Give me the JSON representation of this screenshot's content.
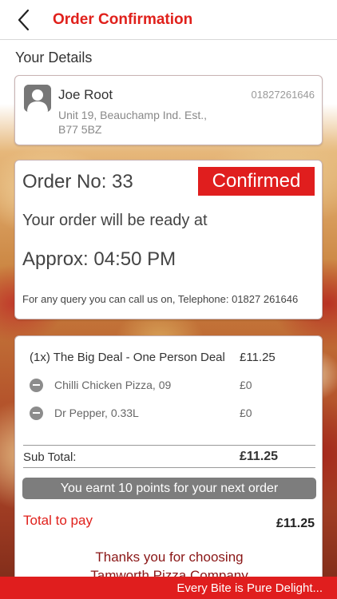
{
  "header": {
    "title": "Order Confirmation"
  },
  "your_details": {
    "section_title": "Your Details",
    "name": "Joe Root",
    "phone": "01827261646",
    "address_line1": "Unit 19, Beauchamp Ind. Est.,",
    "address_line2": "B77 5BZ"
  },
  "order": {
    "number_label": "Order No: 33",
    "status": "Confirmed",
    "ready_text": "Your order will be ready at",
    "approx_time": "Approx: 04:50 PM",
    "query_text": "For any query you can call us on, Telephone: 01827 261646"
  },
  "items": {
    "main": {
      "label": "(1x) The Big Deal - One Person Deal",
      "price": "£11.25"
    },
    "sub_items": [
      {
        "label": "Chilli Chicken Pizza, 09",
        "price": "£0"
      },
      {
        "label": "Dr Pepper, 0.33L",
        "price": "£0"
      }
    ],
    "subtotal_label": "Sub Total:",
    "subtotal_value": "£11.25",
    "points_text": "You earnt 10 points for your next order",
    "total_label": "Total to pay",
    "total_value": "£11.25",
    "thanks_line1": "Thanks you for choosing",
    "thanks_line2": "Tamworth Pizza Company"
  },
  "footer": {
    "tagline": "Every Bite is Pure Delight..."
  },
  "colors": {
    "accent": "#e01e1e",
    "badge": "#e01e1e",
    "points_banner": "#7d7d7d"
  },
  "icons": {
    "back": "chevron-left-icon",
    "avatar": "person-icon",
    "sub_item": "minus-circle-icon"
  }
}
